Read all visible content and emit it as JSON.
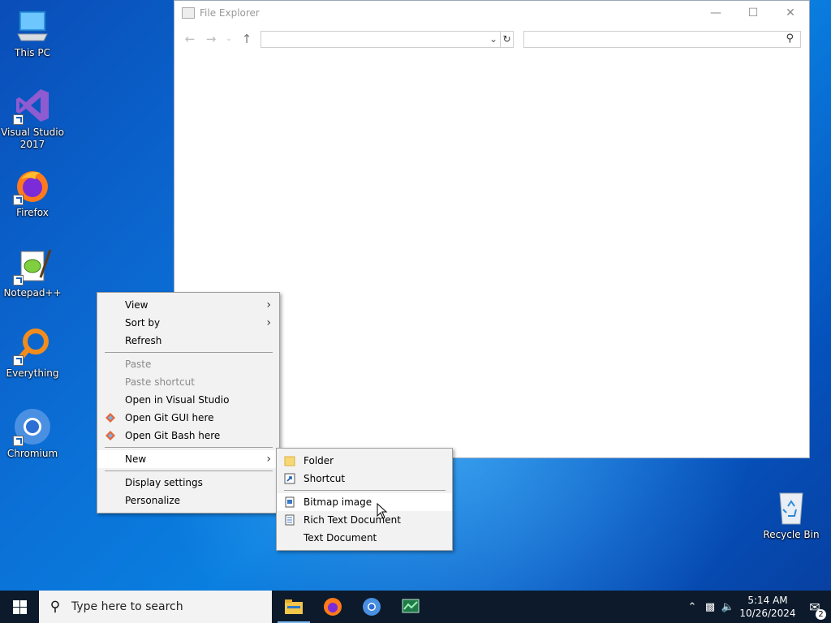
{
  "desktop": {
    "icons": [
      {
        "label": "This PC"
      },
      {
        "label": "Visual Studio\n2017"
      },
      {
        "label": "Firefox"
      },
      {
        "label": "Notepad++"
      },
      {
        "label": "Everything"
      },
      {
        "label": "Chromium"
      },
      {
        "label": "Recycle Bin"
      }
    ]
  },
  "explorer": {
    "title": "File Explorer",
    "address_value": "",
    "search_value": ""
  },
  "context_menu": {
    "items": [
      {
        "label": "View",
        "has_submenu": true
      },
      {
        "label": "Sort by",
        "has_submenu": true
      },
      {
        "label": "Refresh"
      },
      {
        "label": "Paste",
        "disabled": true
      },
      {
        "label": "Paste shortcut",
        "disabled": true
      },
      {
        "label": "Open in Visual Studio"
      },
      {
        "label": "Open Git GUI here"
      },
      {
        "label": "Open Git Bash here"
      },
      {
        "label": "New",
        "has_submenu": true,
        "highlighted": true
      },
      {
        "label": "Display settings"
      },
      {
        "label": "Personalize"
      }
    ]
  },
  "new_submenu": {
    "items": [
      {
        "label": "Folder"
      },
      {
        "label": "Shortcut"
      },
      {
        "label": "Bitmap image",
        "highlighted": true
      },
      {
        "label": "Rich Text Document"
      },
      {
        "label": "Text Document"
      }
    ]
  },
  "taskbar": {
    "search_placeholder": "Type here to search",
    "clock_time": "5:14 AM",
    "clock_date": "10/26/2024",
    "notification_count": "2"
  },
  "colors": {
    "taskbar_bg": "#0c1a2b",
    "menu_bg": "#f2f2f2",
    "desktop_accent": "#0b6fd6"
  }
}
